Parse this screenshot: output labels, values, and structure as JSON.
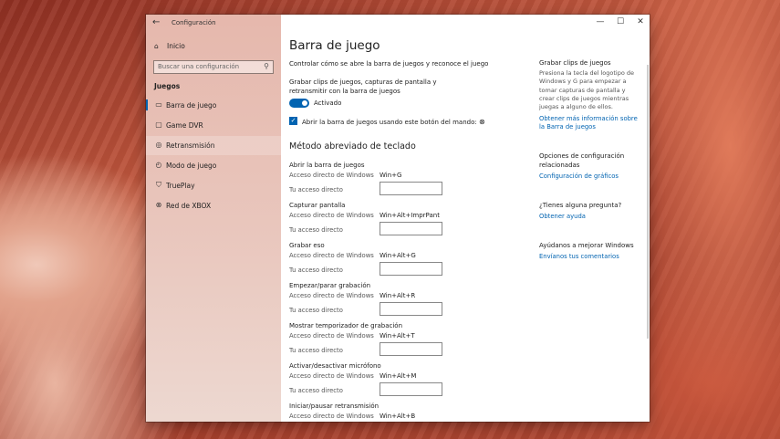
{
  "window": {
    "title": "Configuración",
    "back_icon": "back-arrow-icon",
    "minimize": "—",
    "maximize": "☐",
    "close": "✕"
  },
  "sidebar": {
    "home": "Inicio",
    "search_placeholder": "Buscar una configuración",
    "section": "Juegos",
    "items": [
      {
        "label": "Barra de juego",
        "icon": "game-bar-icon"
      },
      {
        "label": "Game DVR",
        "icon": "game-dvr-icon"
      },
      {
        "label": "Retransmisión",
        "icon": "broadcast-icon"
      },
      {
        "label": "Modo de juego",
        "icon": "game-mode-icon"
      },
      {
        "label": "TruePlay",
        "icon": "trueplay-icon"
      },
      {
        "label": "Red de XBOX",
        "icon": "xbox-icon"
      }
    ]
  },
  "main": {
    "title": "Barra de juego",
    "intro": "Controlar cómo se abre la barra de juegos y reconoce el juego",
    "record_label": "Grabar clips de juegos, capturas de pantalla y retransmitir con la barra de juegos",
    "toggle_state": "Activado",
    "checkbox_label": "Abrir la barra de juegos usando este botón del mando:",
    "shortcuts_title": "Método abreviado de teclado",
    "windows_shortcut_label": "Acceso directo de Windows",
    "your_shortcut_label": "Tu acceso directo",
    "shortcuts": [
      {
        "name": "Abrir la barra de juegos",
        "keys": "Win+G"
      },
      {
        "name": "Capturar pantalla",
        "keys": "Win+Alt+ImprPant"
      },
      {
        "name": "Grabar eso",
        "keys": "Win+Alt+G"
      },
      {
        "name": "Empezar/parar grabación",
        "keys": "Win+Alt+R"
      },
      {
        "name": "Mostrar temporizador de grabación",
        "keys": "Win+Alt+T"
      },
      {
        "name": "Activar/desactivar micrófono",
        "keys": "Win+Alt+M"
      },
      {
        "name": "Iniciar/pausar retransmisión",
        "keys": "Win+Alt+B"
      }
    ]
  },
  "right": {
    "clips_title": "Grabar clips de juegos",
    "clips_text": "Presiona la tecla del logotipo de Windows y G para empezar a tomar capturas de pantalla y crear clips de juegos mientras juegas a alguno de ellos.",
    "clips_link": "Obtener más información sobre la Barra de juegos",
    "related_title": "Opciones de configuración relacionadas",
    "related_link": "Configuración de gráficos",
    "question_title": "¿Tienes alguna pregunta?",
    "help_link": "Obtener ayuda",
    "improve_title": "Ayúdanos a mejorar Windows",
    "feedback_link": "Envíanos tus comentarios"
  },
  "colors": {
    "accent": "#0063b1"
  }
}
